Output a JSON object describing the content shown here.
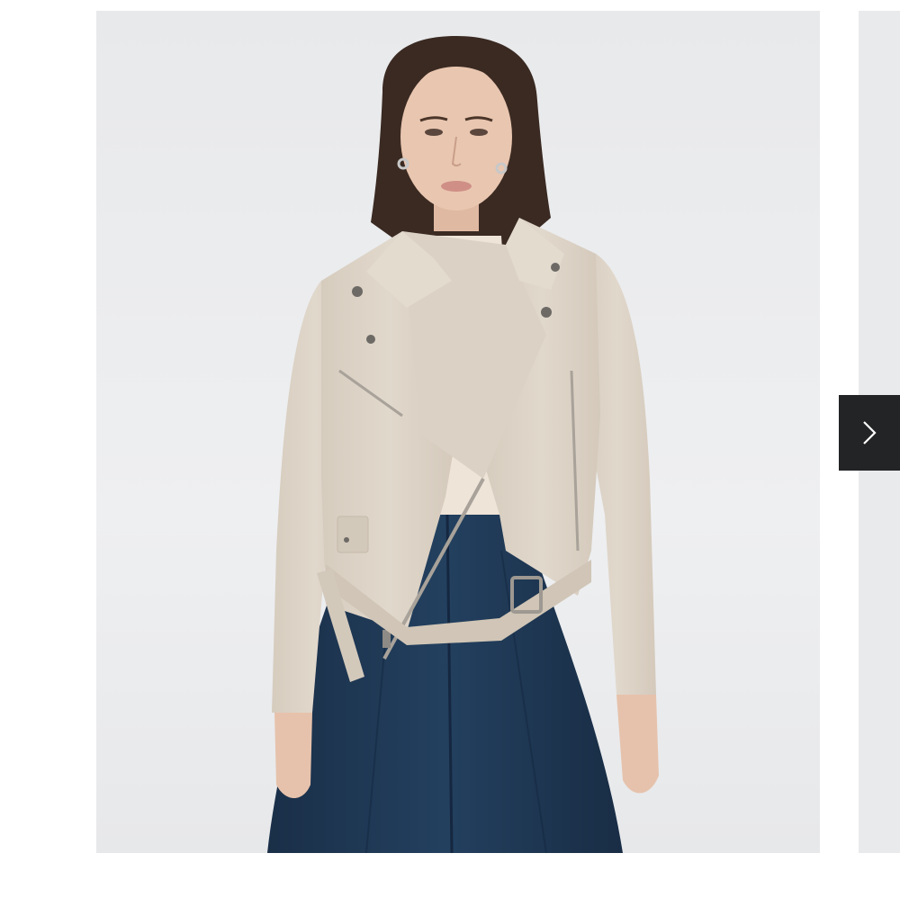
{
  "gallery": {
    "current_image": {
      "alt": "",
      "description_tags": [
        "model",
        "cream-leather-biker-jacket",
        "navy-skirt"
      ]
    },
    "next_button": {
      "icon": "chevron-right-icon",
      "color": "#232425",
      "icon_color": "#ffffff"
    },
    "colors": {
      "background": "#ffffff",
      "photo_backdrop": "#ebecee",
      "jacket": "#ddd3c6",
      "top": "#efe4d8",
      "skirt": "#1d3450",
      "hair": "#3a2a22",
      "skin": "#e6c2ac"
    }
  }
}
